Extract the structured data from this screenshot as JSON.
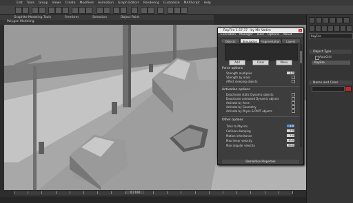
{
  "menubar": {
    "items": [
      "Edit",
      "Tools",
      "Group",
      "Views",
      "Create",
      "Modifiers",
      "Animation",
      "Graph Editors",
      "Rendering",
      "Customize",
      "MAXScript",
      "Help"
    ]
  },
  "tabs": {
    "items": [
      "Graphite Modeling Tools",
      "Freeform",
      "Selection",
      "Object Paint"
    ],
    "sub_label": "Polygon Modeling"
  },
  "command_panel": {
    "dropdown_value": "RayFire",
    "object_type_header": "Object Type",
    "autogrid_label": "AutoGrid",
    "object_button": "RayFire",
    "name_color_header": "Name and Color",
    "color": "#c0282d"
  },
  "rayfire": {
    "title": "RayFire 1.57.37 · by Mir Vadim",
    "menu": [
      "Execution",
      "Manager",
      "Tools",
      "Options",
      "About"
    ],
    "tabs": [
      "Objects",
      "Simulation",
      "Fragmentation",
      "Layers"
    ],
    "buttons": {
      "add": "Add",
      "clear": "Clear",
      "menu": "Menu"
    },
    "force_options": {
      "title": "Force options",
      "strength_multiplier": "Strength multiplier",
      "strength_multiplier_value": "1.0",
      "strength_by_mass": "Strength by mass",
      "affect_sleeping": "Affect sleeping objects"
    },
    "activation_options": {
      "title": "Activation options",
      "deactivate_static": "Deactivate static Dynamic objects",
      "deactivate_animated": "Deactivate animated Dynamic objects",
      "activate_by_force": "Activate by force",
      "activate_by_geometry": "Activate by Geometry",
      "activate_by_physx": "Activate by Physx & PhPT objects"
    },
    "other_options": {
      "title": "Other options",
      "time_scale": "Time to Physics",
      "time_scale_value": "1.0",
      "collision_damping": "Collision damping",
      "collision_damping_value": "1.0",
      "motion_inheritance": "Motion inheritance",
      "motion_inheritance_value": "1.0",
      "max_linear_velocity": "Max linear velocity",
      "max_linear_velocity_value": "10.0",
      "max_angular_velocity": "Max angular velocity",
      "max_angular_velocity_value": "50.0"
    },
    "footer": "Demolition Properties"
  },
  "timeline": {
    "frame_counter": "0 / 100"
  }
}
